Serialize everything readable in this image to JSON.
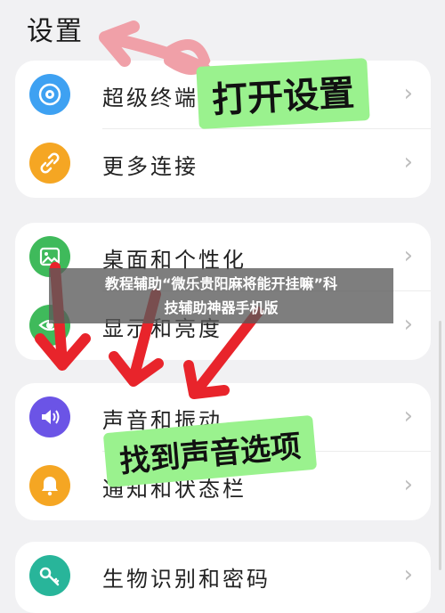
{
  "page_title": "设置",
  "groups": [
    {
      "items": [
        {
          "label": "超级终端",
          "icon": "super-device-icon",
          "color": "#3ea1f2"
        },
        {
          "label": "更多连接",
          "icon": "link-icon",
          "color": "#f5a623"
        }
      ]
    },
    {
      "items": [
        {
          "label": "桌面和个性化",
          "icon": "image-icon",
          "color": "#3fba5b"
        },
        {
          "label": "显示和亮度",
          "icon": "eye-icon",
          "color": "#3fba5b"
        }
      ]
    },
    {
      "items": [
        {
          "label": "声音和振动",
          "icon": "volume-icon",
          "color": "#6b54e6"
        },
        {
          "label": "通知和状态栏",
          "icon": "bell-icon",
          "color": "#f5a623"
        }
      ]
    },
    {
      "items": [
        {
          "label": "生物识别和密码",
          "icon": "key-icon",
          "color": "#28b59a"
        }
      ]
    }
  ],
  "annotations": {
    "open_settings": "打开设置",
    "find_sound": "找到声音选项"
  },
  "banner": {
    "line1": "教程辅助“微乐贵阳麻将能开挂嘛”科",
    "line2": "技辅助神器手机版"
  },
  "colors": {
    "annotation_red": "#e8242b",
    "annotation_pink": "#f0a0a8",
    "highlight_green": "#9af28e"
  }
}
